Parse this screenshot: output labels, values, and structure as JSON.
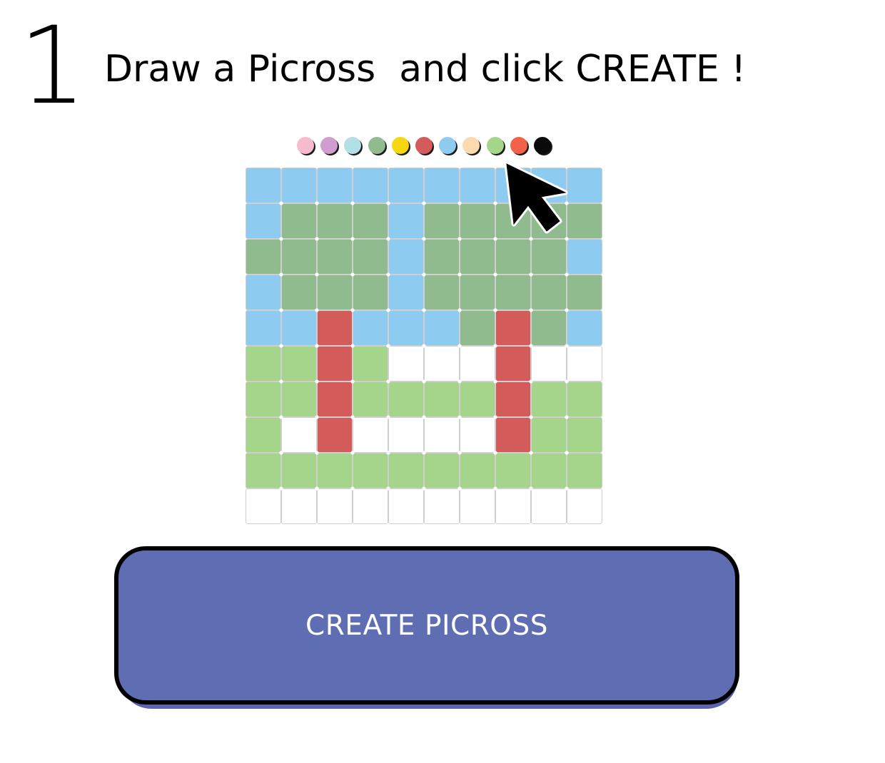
{
  "step": {
    "number": "1",
    "title": "Draw a Picross  and click CREATE !"
  },
  "palette": {
    "colors": [
      "#f6bccd",
      "#cf9ecf",
      "#b3e0e4",
      "#8fbb8e",
      "#f7d70f",
      "#d35b5a",
      "#8ecbf0",
      "#fddbb0",
      "#a5d48b",
      "#f26148",
      "#0a0a0a"
    ]
  },
  "grid": {
    "columns": 10,
    "rows": 10,
    "color_key": {
      "B": "#8ecbf0",
      "D": "#8fbb8e",
      "R": "#d35b5a",
      "L": "#a5d48b",
      "W": "#ffffff"
    },
    "cells": [
      "BBBBBBBBBB",
      "BDDDBDDDDD",
      "DDDDBDDDDB",
      "BDDDBDDDDD",
      "BBRBBBDRDB",
      "LLRLWWWRWW",
      "LLRLLLLRLL",
      "LWRWWWWRLL",
      "LLLLLLLLLL",
      "WWWWWWWWWW"
    ]
  },
  "cursor": {
    "icon": "arrow-cursor-icon"
  },
  "create_button": {
    "label": "CREATE PICROSS",
    "background": "#5f6db3",
    "text_color": "#ffffff"
  }
}
